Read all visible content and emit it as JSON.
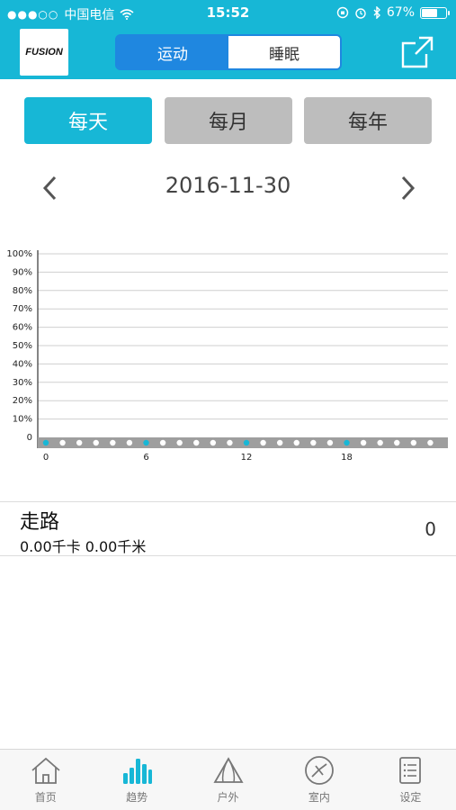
{
  "status_bar": {
    "carrier": "中国电信",
    "time": "15:52",
    "battery_percent": "67%",
    "battery_level": 0.67
  },
  "header": {
    "logo_text": "FUSION",
    "segments": [
      {
        "label": "运动",
        "selected": true
      },
      {
        "label": "睡眠",
        "selected": false
      }
    ],
    "share_icon": "share-icon"
  },
  "periods": [
    {
      "label": "每天",
      "selected": true
    },
    {
      "label": "每月",
      "selected": false
    },
    {
      "label": "每年",
      "selected": false
    }
  ],
  "date_nav": {
    "date": "2016-11-30"
  },
  "chart_data": {
    "type": "bar",
    "y_ticks": [
      "100%",
      "90%",
      "80%",
      "70%",
      "60%",
      "50%",
      "40%",
      "30%",
      "20%",
      "10%",
      "0"
    ],
    "x_tick_labels": [
      "0",
      "6",
      "12",
      "18"
    ],
    "x": [
      0,
      1,
      2,
      3,
      4,
      5,
      6,
      7,
      8,
      9,
      10,
      11,
      12,
      13,
      14,
      15,
      16,
      17,
      18,
      19,
      20,
      21,
      22,
      23
    ],
    "values": [
      0,
      0,
      0,
      0,
      0,
      0,
      0,
      0,
      0,
      0,
      0,
      0,
      0,
      0,
      0,
      0,
      0,
      0,
      0,
      0,
      0,
      0,
      0,
      0
    ],
    "ylim": [
      0,
      100
    ],
    "highlight_color": "#17b7d6"
  },
  "activity": {
    "title": "走路",
    "summary": "0.00千卡 0.00千米",
    "count": "0"
  },
  "tabbar": [
    {
      "label": "首页",
      "icon": "home-icon",
      "active": false
    },
    {
      "label": "趋势",
      "icon": "trend-icon",
      "active": true
    },
    {
      "label": "户外",
      "icon": "tent-icon",
      "active": false
    },
    {
      "label": "室内",
      "icon": "indoor-icon",
      "active": false
    },
    {
      "label": "设定",
      "icon": "settings-icon",
      "active": false
    }
  ],
  "colors": {
    "accent": "#17b7d6",
    "segment_blue": "#1f87e0"
  }
}
